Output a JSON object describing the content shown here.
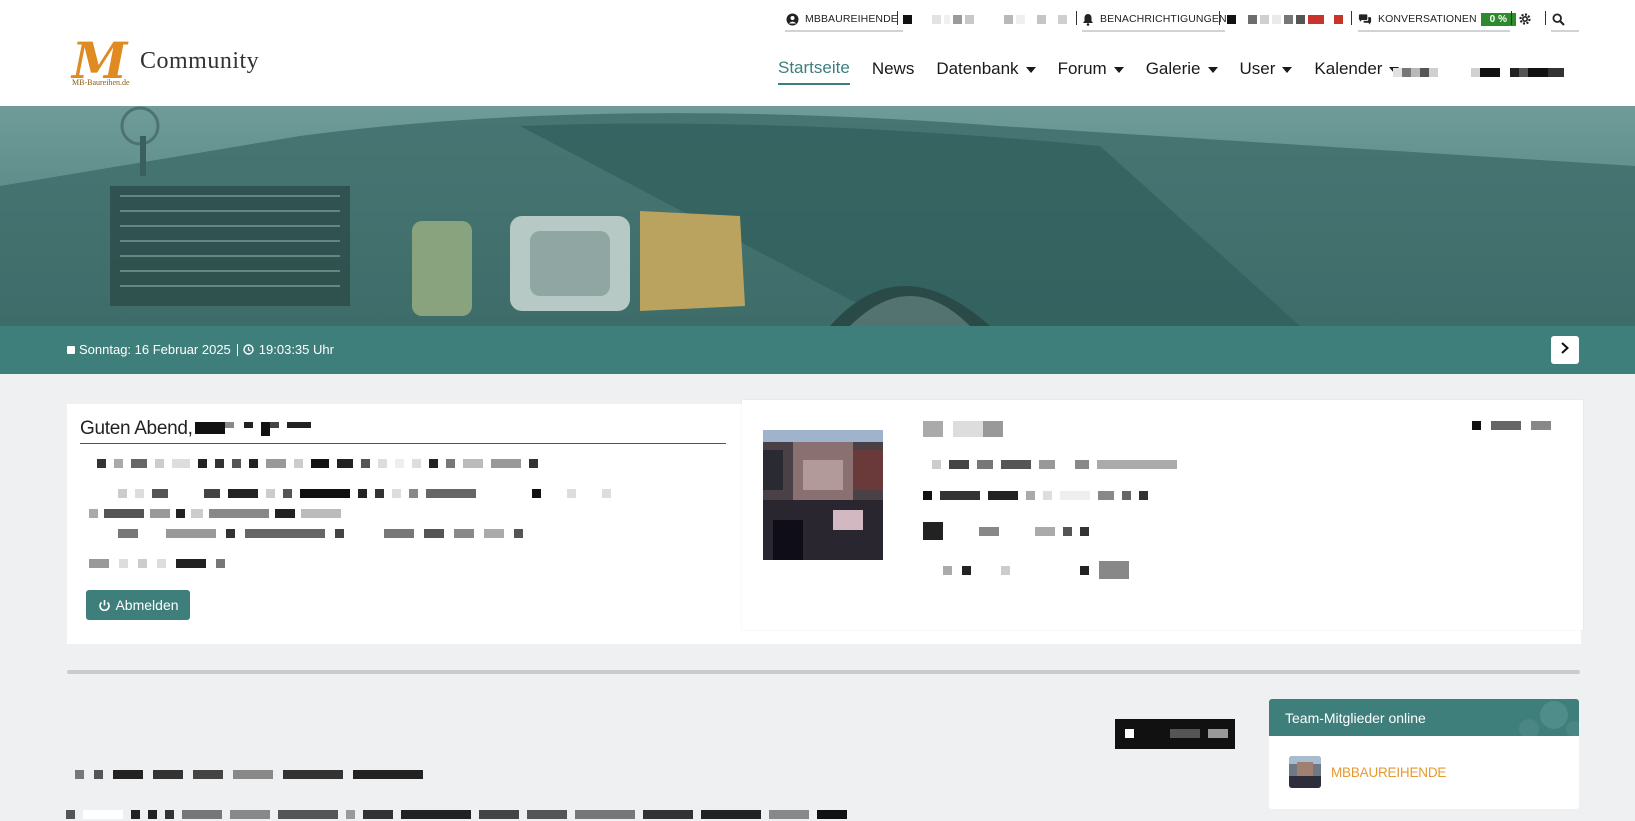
{
  "utilbar": {
    "user_label": "MBBAUREIHENDE",
    "notifications_label": "BENACHRICHTIGUNGEN",
    "conversations_label": "KONVERSATIONEN",
    "conversations_badge": "0 %"
  },
  "header": {
    "logo_mark": "M",
    "logo_sub": "MB-Baureihen.de",
    "logo_text": "Community",
    "nav": [
      {
        "label": "Startseite",
        "active": true
      },
      {
        "label": "News"
      },
      {
        "label": "Datenbank",
        "dropdown": true
      },
      {
        "label": "Forum",
        "dropdown": true
      },
      {
        "label": "Galerie",
        "dropdown": true
      },
      {
        "label": "User",
        "dropdown": true
      },
      {
        "label": "Kalender",
        "dropdown": true
      }
    ]
  },
  "datebar": {
    "date": "Sonntag: 16 Februar 2025",
    "time": "19:03:35 Uhr"
  },
  "welcome": {
    "greeting": "Guten Abend,",
    "logout_label": "Abmelden"
  },
  "team": {
    "title": "Team-Mitglieder online",
    "members": [
      "MBBAUREIHENDE"
    ]
  },
  "colors": {
    "accent": "#3e7e7b",
    "active_nav": "#3c7f7e",
    "member_name": "#e59a30",
    "badge_green": "#2d8a2d"
  }
}
